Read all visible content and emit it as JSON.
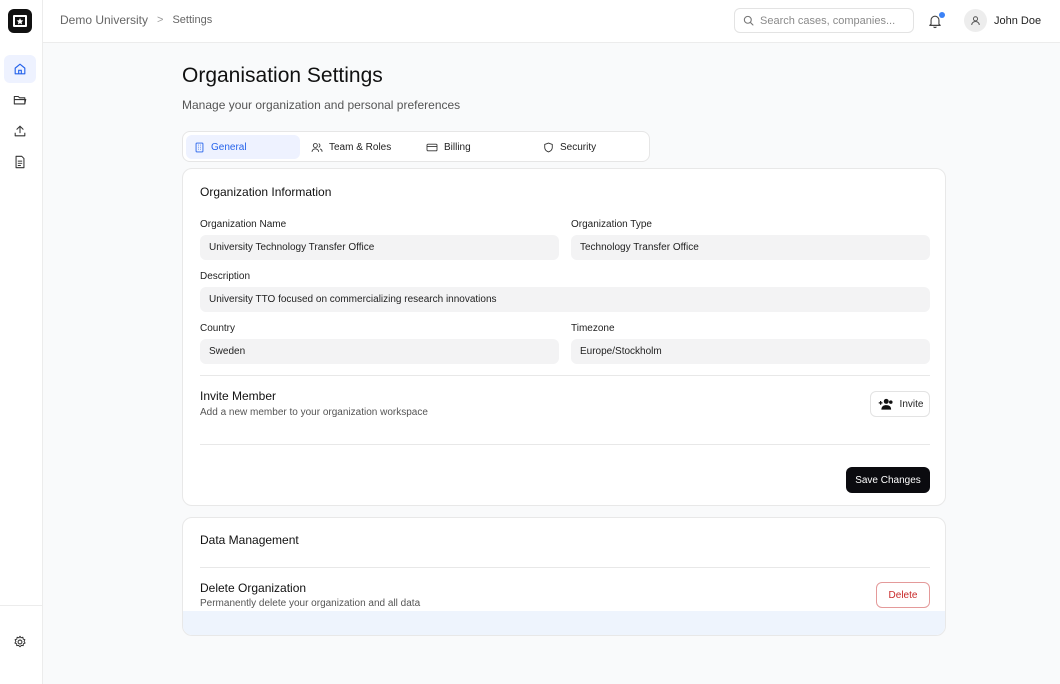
{
  "breadcrumb": {
    "root": "Demo University",
    "separator": ">",
    "current": "Settings"
  },
  "search": {
    "placeholder": "Search cases, companies..."
  },
  "user": {
    "name": "John Doe"
  },
  "notifications": {
    "has_unread": true
  },
  "sidebar": {
    "items": [
      {
        "icon": "home-icon",
        "active": true
      },
      {
        "icon": "folder-icon",
        "active": false
      },
      {
        "icon": "upload-icon",
        "active": false
      },
      {
        "icon": "document-icon",
        "active": false
      }
    ],
    "footer_icon": "gear-icon"
  },
  "page": {
    "title": "Organisation Settings",
    "subtitle": "Manage your organization and personal preferences"
  },
  "tabs": [
    {
      "label": "General",
      "icon": "building-icon",
      "active": true
    },
    {
      "label": "Team & Roles",
      "icon": "users-icon",
      "active": false
    },
    {
      "label": "Billing",
      "icon": "credit-card-icon",
      "active": false
    },
    {
      "label": "Security",
      "icon": "shield-icon",
      "active": false
    }
  ],
  "org_info": {
    "title": "Organization Information",
    "name_label": "Organization Name",
    "name_value": "University Technology Transfer Office",
    "type_label": "Organization Type",
    "type_value": "Technology Transfer Office",
    "description_label": "Description",
    "description_value": "University TTO focused on commercializing research innovations",
    "country_label": "Country",
    "country_value": "Sweden",
    "timezone_label": "Timezone",
    "timezone_value": "Europe/Stockholm"
  },
  "invite": {
    "title": "Invite Member",
    "subtitle": "Add a new member to your organization workspace",
    "button_label": "Invite"
  },
  "save_label": "Save Changes",
  "data_management": {
    "title": "Data Management",
    "delete_title": "Delete Organization",
    "delete_subtitle": "Permanently delete your organization and all data",
    "delete_button": "Delete"
  },
  "colors": {
    "accent": "#2563eb",
    "danger": "#c92a2a",
    "primary_button": "#0b0b0f",
    "notification_dot": "#3b82f6"
  }
}
